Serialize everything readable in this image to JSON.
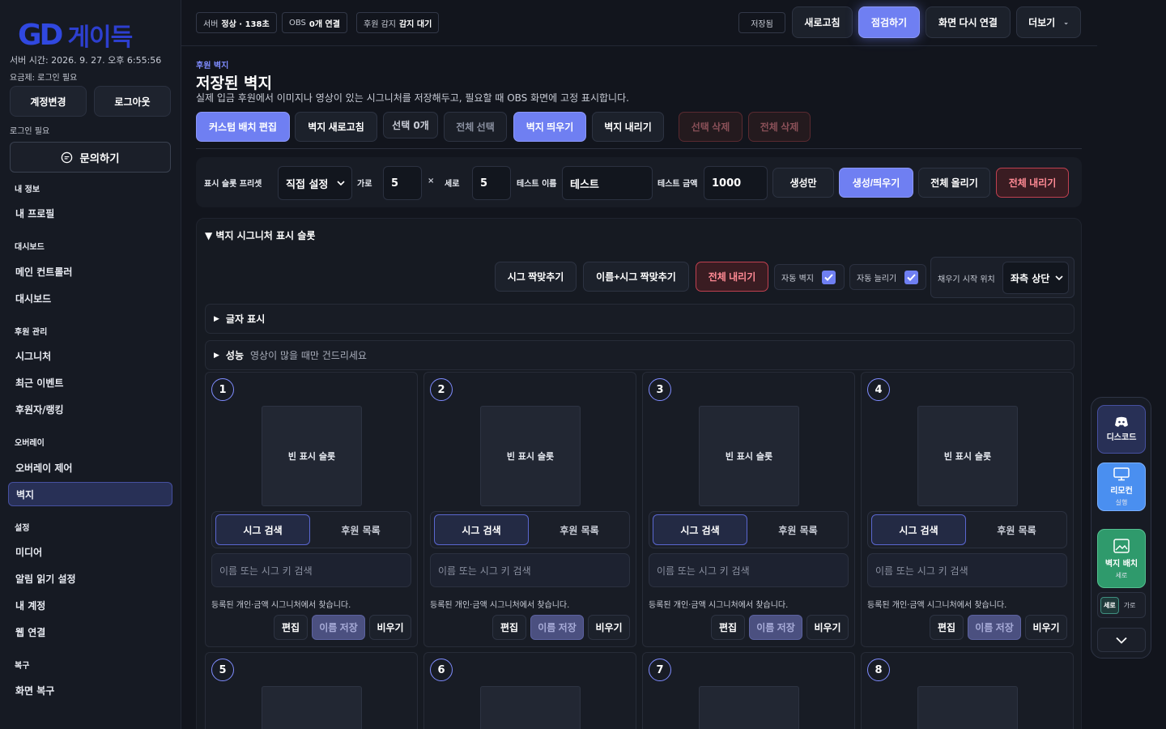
{
  "sidebar": {
    "logo_text": "게이득",
    "server_time": "서버 시간: 2026. 9. 27. 오후 6:55:56",
    "plan": "요금제: 로그인 필요",
    "account_change": "계정변경",
    "logout": "로그아웃",
    "login_required": "로그인 필요",
    "inquiry": "문의하기",
    "sections": [
      {
        "title": "내 정보",
        "items": [
          "내 프로필"
        ]
      },
      {
        "title": "대시보드",
        "items": [
          "메인 컨트롤러",
          "대시보드"
        ]
      },
      {
        "title": "후원 관리",
        "items": [
          "시그니처",
          "최근 이벤트",
          "후원자/랭킹"
        ]
      },
      {
        "title": "오버레이",
        "items": [
          "오버레이 제어",
          "벽지"
        ]
      },
      {
        "title": "설정",
        "items": [
          "미디어",
          "알림 읽기 설정",
          "내 계정",
          "웹 연결"
        ]
      },
      {
        "title": "복구",
        "items": [
          "화면 복구"
        ]
      }
    ],
    "active_item": "벽지"
  },
  "topbar": {
    "server_label": "서버",
    "server_value": "정상 · 138초",
    "obs_label": "OBS",
    "obs_value": "0개 연결",
    "detect_label": "후원 감지",
    "detect_value": "감지 대기",
    "saved": "저장됨",
    "refresh": "새로고침",
    "inspect": "점검하기",
    "reconnect": "화면 다시 연결",
    "more": "더보기"
  },
  "page": {
    "kicker": "후원 벽지",
    "title": "저장된 벽지",
    "description": "실제 입금 후원에서 이미지나 영상이 있는 시그니처를 저장해두고, 필요할 때 OBS 화면에 고정 표시합니다."
  },
  "actions": {
    "custom_edit": "커스텀 배치 편집",
    "wall_refresh": "벽지 새로고침",
    "selected_count": "선택 0개",
    "select_all": "전체 선택",
    "wall_show": "벽지 띄우기",
    "wall_hide": "벽지 내리기",
    "delete_selected": "선택 삭제",
    "delete_all": "전체 삭제"
  },
  "panel": {
    "preset_label": "표시 슬롯 프리셋",
    "preset_value": "직접 설정",
    "cols_label": "가로",
    "cols_value": "5",
    "times": "×",
    "rows_label": "세로",
    "rows_value": "5",
    "test_name_label": "테스트 이름",
    "test_name_value": "테스트",
    "test_amount_label": "테스트 금액",
    "test_amount_value": "1000",
    "create_only": "생성만",
    "create_show": "생성/띄우기",
    "raise_all": "전체 올리기",
    "lower_all": "전체 내리기"
  },
  "signature_section": {
    "title": "벽지 시그니처 표시 슬롯",
    "sig_match": "시그 짝맞추기",
    "name_sig_match": "이름+시그 짝맞추기",
    "lower_all": "전체 내리기",
    "auto_wall": "자동 벽지",
    "auto_grow": "자동 늘리기",
    "fill_start_label": "채우기 시작 위치",
    "fill_start_value": "좌측 상단",
    "text_display": "글자 표시",
    "performance": "성능",
    "performance_hint": "영상이 많을 때만 건드리세요"
  },
  "slots": [
    {
      "num": "1"
    },
    {
      "num": "2"
    },
    {
      "num": "3"
    },
    {
      "num": "4"
    },
    {
      "num": "5"
    },
    {
      "num": "6"
    },
    {
      "num": "7"
    },
    {
      "num": "8"
    }
  ],
  "slot_text": {
    "empty": "빈 표시 슬롯",
    "tab_search": "시그 검색",
    "tab_list": "후원 목록",
    "search_placeholder": "이름 또는 시그 키 검색",
    "help": "등록된 개인·금액 시그니처에서 찾습니다.",
    "edit": "편집",
    "save_name": "이름 저장",
    "clear": "비우기"
  },
  "fab": {
    "discord": "디스코드",
    "remote": "리모컨",
    "remote_sub": "실행",
    "wall_layout": "벽지 배치",
    "wall_layout_sub": "세로",
    "toggle_vertical": "세로",
    "toggle_horizontal": "가로"
  },
  "colors": {
    "accent": "#6f7ff2",
    "danger": "#c04050",
    "sidebar_bg": "#161a23",
    "remote_bg": "#4a8ff0",
    "wall_bg": "#2f9a6c"
  }
}
